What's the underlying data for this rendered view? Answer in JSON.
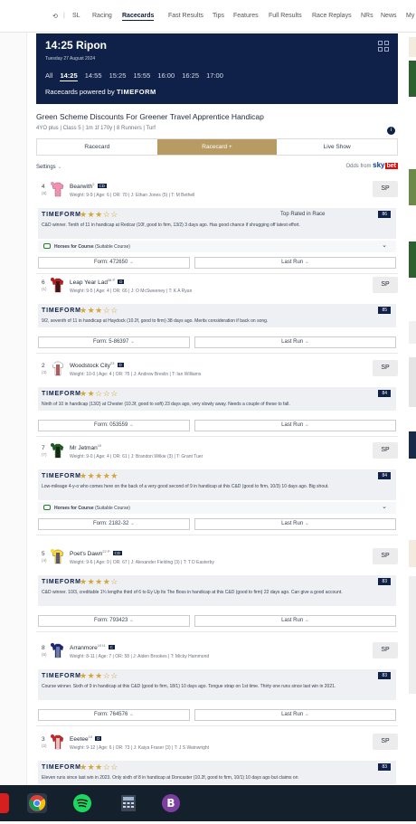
{
  "nav": {
    "items": [
      "SL",
      "Racing",
      "Racecards",
      "Fast Results",
      "Tips",
      "Features",
      "Full Results",
      "Race Replays",
      "NRs",
      "News",
      "My"
    ],
    "active": "Racecards"
  },
  "header": {
    "time": "14:25 Ripon",
    "date": "Tuesday 27 August 2024",
    "all_label": "All",
    "times": [
      "14:25",
      "14:55",
      "15:25",
      "15:55",
      "16:00",
      "16:25",
      "17:00"
    ],
    "selected_time": "14:25",
    "powered_by": "Racecards powered by",
    "tf_brand": "TIMEFORM"
  },
  "race": {
    "title": "Green Scheme Discounts For Greener Travel Apprentice Handicap",
    "info": "4YO plus | Class 5 | 1m 1f 170y | 8 Runners | Turf"
  },
  "tabs": [
    "Racecard",
    "Racecard +",
    "Live Show"
  ],
  "settings_label": "Settings",
  "odds_from": "Odds from",
  "sky": "sky",
  "bet": "bet",
  "sp_label": "SP",
  "tf_logo": "TIMEFORM",
  "form_label": "Form:",
  "last_run_label": "Last Run",
  "horses_course_label": "Horses for Course",
  "horses_course_note": "(Suitable Course)",
  "top_rated_label": "Top Rated in Race",
  "runners": [
    {
      "num": "4",
      "draw": "(5)",
      "name": "Bearwith",
      "sup": "2",
      "badge": "CD",
      "meta": "Weight: 9-9 | Age: 6 | OR: 70 | J: Ethan Jones (5) | T: M Bethell",
      "stars": 3,
      "rating": "86",
      "top": true,
      "comment": "C&D winner. Tenth of 11 in handicap at Redcar (10f, good to firm, 13/2) 3 days ago. Has good chance if shrugging off latest effort.",
      "course": true,
      "form": "472650"
    },
    {
      "num": "6",
      "draw": "(1)",
      "name": "Leap Year Lad",
      "sup": "38 P",
      "badge": "D",
      "meta": "Weight: 9-5 | Age: 4 | OR: 66 | J: O McSweeney | T: K A Ryan",
      "stars": 3,
      "rating": "85",
      "top": false,
      "comment": "9/2, seventh of 11 in handicap at Haydock (10.2f, good to firm) 38 days ago. Merits consideration if back on song.",
      "course": false,
      "form": "5-86397"
    },
    {
      "num": "2",
      "draw": "(3)",
      "name": "Woodstock City",
      "sup": "23",
      "badge": "D",
      "meta": "Weight: 10-0 | Age: 4 | OR: 75 | J: Andrew Breslin | T: Ian Williams",
      "stars": 2,
      "rating": "84",
      "top": false,
      "comment": "Ninth of 10 in handicap (13/2) at Chester (10.3f, good to soft) 23 days ago, very slowly away. Needs a couple of these to fall.",
      "course": false,
      "form": "053559"
    },
    {
      "num": "7",
      "draw": "(7)",
      "name": "Mr Jetman",
      "sup": "10",
      "badge": "",
      "meta": "Weight: 9-0 | Age: 4 | OR: 61 | J: Brandon Wilkie (3) | T: Grant Tuer",
      "stars": 5,
      "rating": "84",
      "top": false,
      "comment": "Low-mileage 4-y-o who comes here on the back of a very good second of 9 in handicap at this C&D (good to firm, 10/3) 10 days ago. Big shout.",
      "course": true,
      "form": "2182-32"
    },
    {
      "num": "5",
      "draw": "(4)",
      "name": "Poet's Dawn",
      "sup": "22 P",
      "badge": "CD",
      "meta": "Weight: 9-6 | Age: 9 | OR: 67 | J: Alexander Fielding (3) | T: T D Easterby",
      "stars": 4,
      "rating": "83",
      "top": false,
      "comment": "C&D winner. 10/3, creditable 1¾ lengths third of 6 to Ey Up Its The Boss in handicap at this C&D (good to firm) 22 days ago. Can give a good account.",
      "course": false,
      "form": "793423"
    },
    {
      "num": "8",
      "draw": "(6)",
      "name": "Arranmore",
      "sup": "10 t1",
      "badge": "C",
      "meta": "Weight: 8-11 | Age: 7 | OR: 58 | J: Aiden Brookes | T: Micky Hammond",
      "stars": 3,
      "rating": "83",
      "top": false,
      "comment": "Course winner. Sixth of 9 in handicap at this C&D (good to firm, 18/1) 10 days ago. Tongue strap on 1st time. Thirty one runs since last win in 2021.",
      "course": false,
      "form": "764576"
    },
    {
      "num": "3",
      "draw": "(2)",
      "name": "Eeetee",
      "sup": "10",
      "badge": "D",
      "meta": "Weight: 9-12 | Age: 6 | OR: 73 | J: Kaiya Fraser (3) | T: J S Wainwright",
      "stars": 3,
      "rating": "83",
      "top": false,
      "comment": "Eleven runs since last win in 2023. Only sixth of 8 in handicap at Doncaster (10.2f, good to firm, 10/1) 10 days ago but claims on",
      "course": false,
      "form": ""
    }
  ]
}
